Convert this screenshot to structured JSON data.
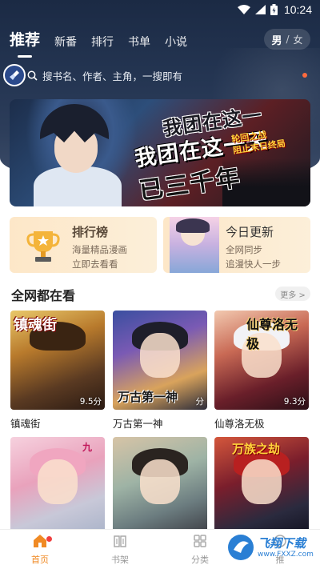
{
  "status_bar": {
    "time": "10:24"
  },
  "header": {
    "tabs": [
      {
        "label": "推荐",
        "active": true
      },
      {
        "label": "新番",
        "active": false
      },
      {
        "label": "排行",
        "active": false
      },
      {
        "label": "书单",
        "active": false
      },
      {
        "label": "小说",
        "active": false
      }
    ],
    "gender": {
      "male": "男",
      "separator": "/",
      "female": "女"
    }
  },
  "search": {
    "placeholder": "搜书名、作者、主角，一搜即有"
  },
  "banner": {
    "title_top": "我团在这一",
    "title_main": "我团在这一天",
    "title_bottom": "已三千年",
    "subtitle_1": "轮回之战",
    "subtitle_2": "阻止末日终局"
  },
  "feature_cards": {
    "rank": {
      "title": "排行榜",
      "line1": "海量精品漫画",
      "line2": "立即去看看"
    },
    "today": {
      "title": "今日更新",
      "line1": "全网同步",
      "line2": "追漫快人一步"
    }
  },
  "section": {
    "title": "全网都在看",
    "more_label": "更多 >",
    "comics": [
      {
        "title": "镇魂街",
        "score": "9.5分",
        "cover_text": "镇魂街"
      },
      {
        "title": "万古第一神",
        "score": "分",
        "cover_text": "万古第一神"
      },
      {
        "title": "仙尊洛无极",
        "score": "9.3分",
        "cover_text": "仙尊洛无极"
      },
      {
        "title": "",
        "score": "",
        "cover_text": "九"
      },
      {
        "title": "",
        "score": "",
        "cover_text": ""
      },
      {
        "title": "",
        "score": "",
        "cover_text": "万族之劫"
      }
    ]
  },
  "bottom_nav": {
    "items": [
      {
        "label": "首页",
        "icon": "home-icon",
        "active": true
      },
      {
        "label": "书架",
        "icon": "bookshelf-icon",
        "active": false
      },
      {
        "label": "分类",
        "icon": "category-grid-icon",
        "active": false
      },
      {
        "label": "推",
        "icon": "recommend-icon",
        "active": false
      }
    ]
  },
  "watermark": {
    "main": "飞翔下载",
    "url": "www.FXXZ.com"
  },
  "colors": {
    "accent": "#f08a24",
    "header_bg": "#243552",
    "card_bg": "#fcefd9",
    "notification": "#f04040"
  }
}
